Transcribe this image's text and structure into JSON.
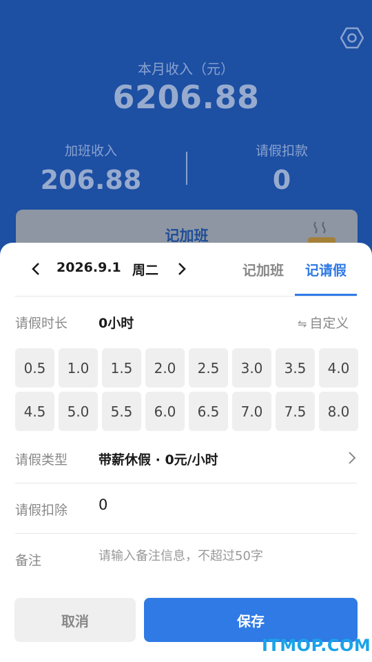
{
  "header": {
    "month_income_label": "本月收入（元）",
    "month_income_value": "6206.88",
    "overtime_income_label": "加班收入",
    "overtime_income_value": "206.88",
    "leave_deduction_label": "请假扣款",
    "leave_deduction_value": "0",
    "overtime_card_label": "记加班",
    "settings_icon": "gear-icon",
    "cup_icon": "coffee-cup-icon"
  },
  "sheet": {
    "date": "2026.9.1",
    "weekday": "周二",
    "tabs": [
      {
        "label": "记加班",
        "active": false
      },
      {
        "label": "记请假",
        "active": true
      }
    ],
    "duration": {
      "label": "请假时长",
      "value": "0小时",
      "custom_label": "自定义",
      "custom_icon": "swap-icon"
    },
    "duration_options": [
      "0.5",
      "1.0",
      "1.5",
      "2.0",
      "2.5",
      "3.0",
      "3.5",
      "4.0",
      "4.5",
      "5.0",
      "5.5",
      "6.0",
      "6.5",
      "7.0",
      "7.5",
      "8.0"
    ],
    "leave_type": {
      "label": "请假类型",
      "value": "带薪休假 · 0元/小时"
    },
    "deduction": {
      "label": "请假扣除",
      "value": "0"
    },
    "note": {
      "label": "备注",
      "placeholder": "请输入备注信息，不超过50字",
      "value": ""
    },
    "cancel_label": "取消",
    "save_label": "保存"
  },
  "watermark": "ITMOP.COM",
  "colors": {
    "header_bg": "#1d4fa3",
    "accent": "#2f7ae5",
    "chip_bg": "#efefef",
    "muted_text": "#888888",
    "watermark": "#1aa3e8"
  }
}
